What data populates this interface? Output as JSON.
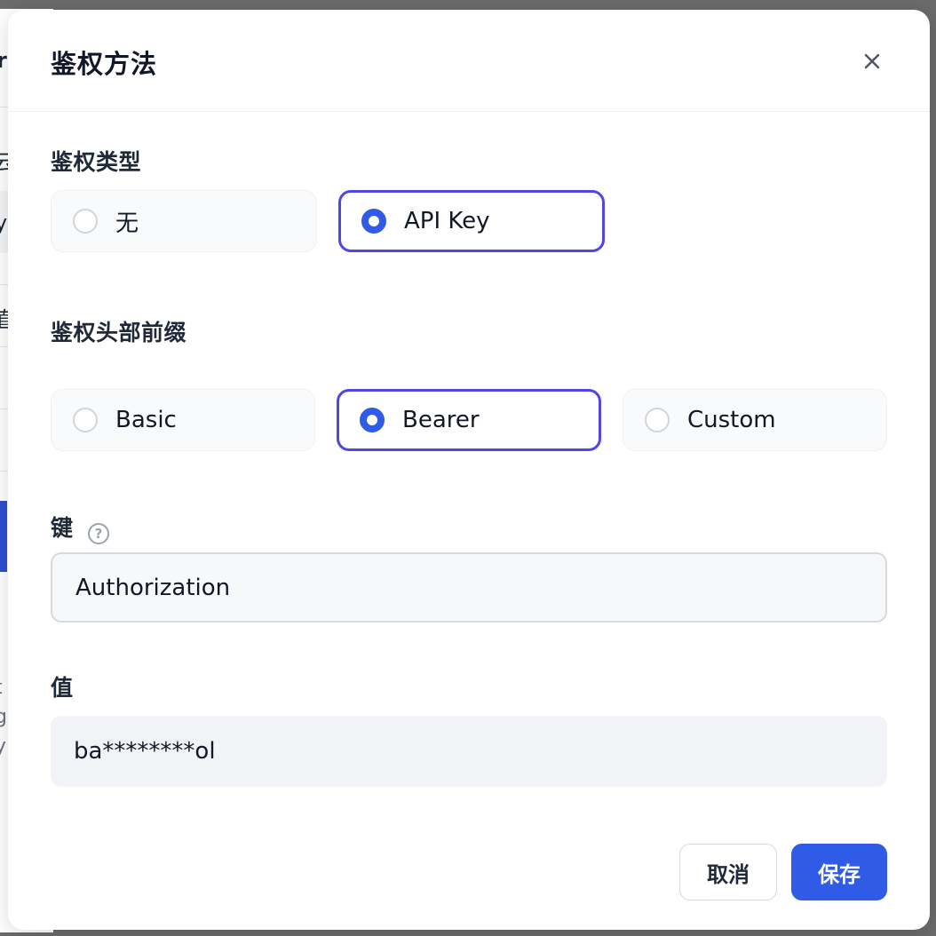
{
  "background": {
    "fragments": [
      "r",
      "云",
      "y",
      "值",
      "t",
      "g",
      "y"
    ]
  },
  "dialog": {
    "title": "鉴权方法",
    "close_icon": "close-icon"
  },
  "auth_type": {
    "label": "鉴权类型",
    "options": [
      {
        "label": "无",
        "selected": false
      },
      {
        "label": "API Key",
        "selected": true
      }
    ]
  },
  "header_prefix": {
    "label": "鉴权头部前缀",
    "options": [
      {
        "label": "Basic",
        "selected": false
      },
      {
        "label": "Bearer",
        "selected": true
      },
      {
        "label": "Custom",
        "selected": false
      }
    ]
  },
  "key_field": {
    "label": "键",
    "help_icon": "question-circle-icon",
    "help_glyph": "?",
    "value": "Authorization"
  },
  "value_field": {
    "label": "值",
    "value": "ba********ol"
  },
  "footer": {
    "cancel_label": "取消",
    "save_label": "保存"
  },
  "colors": {
    "accent": "#2f5be6",
    "selected_border": "#4f46e5",
    "overlay": "#6b6b6b"
  }
}
